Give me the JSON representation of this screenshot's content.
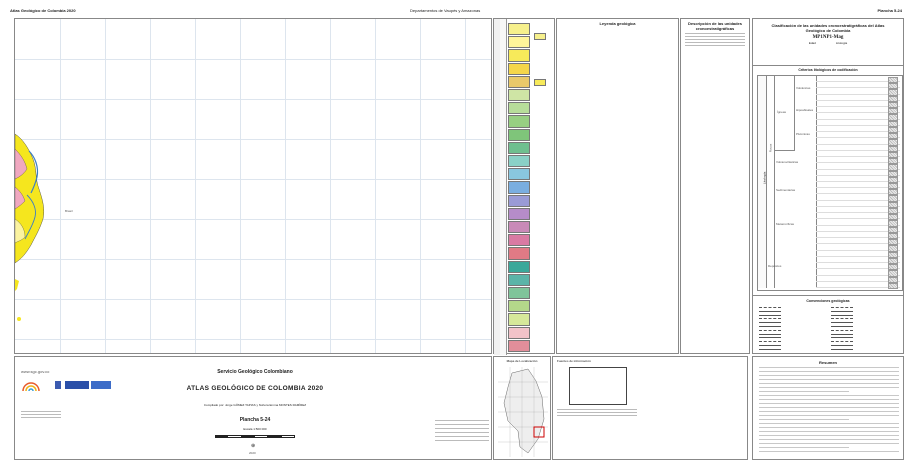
{
  "header": {
    "left": "Atlas Geológico de Colombia 2020",
    "center": "Departamentos de Vaupés y Amazonas",
    "right": "Plancha 5-24"
  },
  "map": {
    "country_label": "Brasil",
    "colors": {
      "yellow": "#f5e61e",
      "pink": "#f0a8c0",
      "water": "#9ed8f0",
      "lightyellow": "#fbf3a0"
    }
  },
  "strat": {
    "legend_title": "Leyenda geológica",
    "desc_title": "Descripción de las unidades cronoestratigráficas",
    "colors": [
      "#f6f08c",
      "#fff59a",
      "#f7ea5a",
      "#f5d64a",
      "#e9c96a",
      "#cfe5a5",
      "#b7dd9a",
      "#97cf82",
      "#7fc57a",
      "#6fbf8f",
      "#8ad1c7",
      "#89c7df",
      "#7aaee0",
      "#9a9bd6",
      "#b68cc9",
      "#c98ab8",
      "#d97aa3",
      "#e07a85",
      "#3aa89a",
      "#5bb4a8",
      "#7fc49a",
      "#b4d88a",
      "#d6e89a",
      "#f2c3c9",
      "#e28e9a"
    ]
  },
  "classif": {
    "title": "Clasificación de las unidades cronoestratigráficas del Atlas Geológico de Colombia",
    "example_code": "MP1NP1-Mag",
    "era_label": "Edad",
    "litho_label": "Litología",
    "criteria_title": "Criterios litológicos de codificación",
    "group_ignea": "Ígneas",
    "group_rocas": "Rocas",
    "group_litologia": "Litología",
    "rows": [
      "Volcánicas",
      "Hipoabisales",
      "Plutónicas",
      "Volcanoclásticas",
      "Sedimentarias",
      "Metamórficas",
      "Depósitos"
    ],
    "conv_title": "Convenciones geológicas"
  },
  "lower": {
    "website": "www.sgc.gov.co",
    "sgc_title": "Servicio Geológico Colombiano",
    "atlas_title": "ATLAS GEOLÓGICO DE COLOMBIA 2020",
    "compiled": "Compilado por: Jorge GÓMEZ TAPIAS y Nohora Emma MONTES RAMÍREZ",
    "plancha": "Plancha 5-24",
    "scale": "Escala 1:500 000",
    "year": "2020",
    "loc_title": "Mapa de Localización",
    "src_title": "Fuentes de información",
    "resumen_title": "Resumen"
  }
}
